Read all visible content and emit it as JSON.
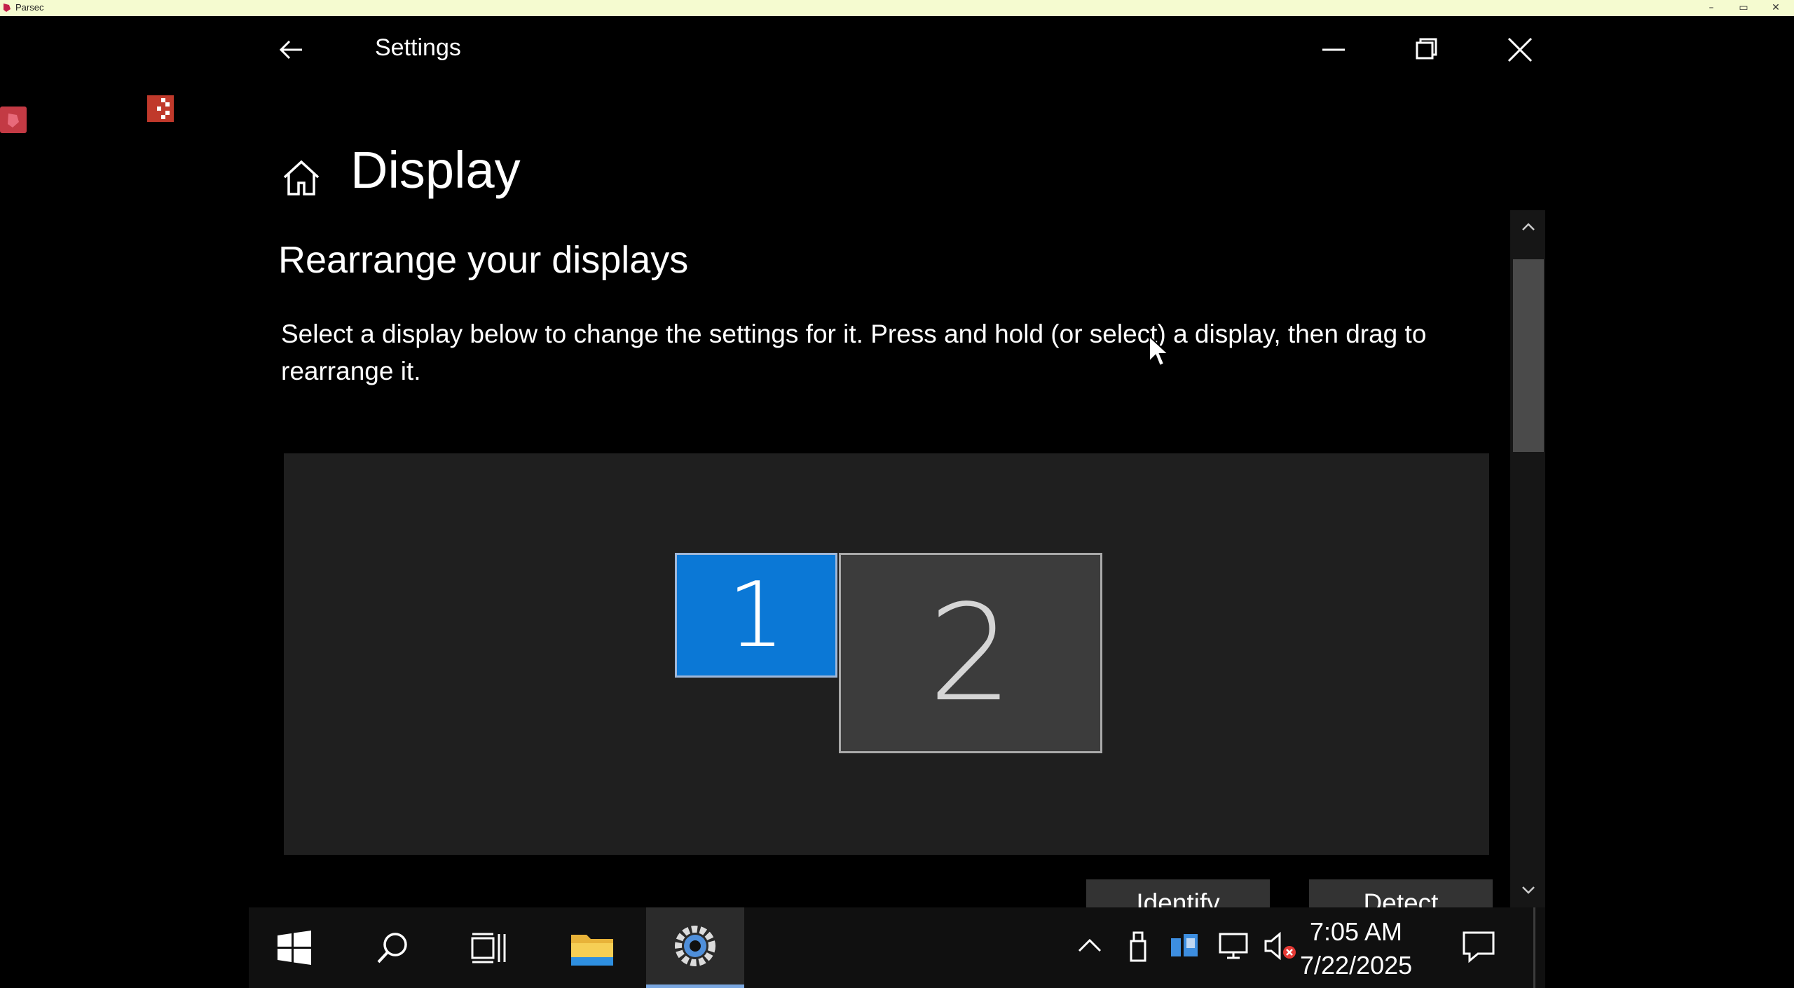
{
  "host": {
    "title": "Parsec",
    "minimize": "–",
    "maximize": "▭",
    "close": "✕"
  },
  "window": {
    "title": "Settings",
    "page_title": "Display",
    "section_title": "Rearrange your displays",
    "description": "Select a display below to change the settings for it. Press and hold (or select) a display, then drag to rearrange it.",
    "monitors": [
      {
        "label": "1",
        "selected": true
      },
      {
        "label": "2",
        "selected": false
      }
    ],
    "buttons": {
      "identify": "Identify",
      "detect": "Detect"
    }
  },
  "taskbar": {
    "time": "7:05 AM",
    "date": "7/22/2025",
    "icons": [
      "start-icon",
      "search-icon",
      "task-view-icon",
      "file-explorer-icon",
      "settings-app-icon"
    ],
    "tray": [
      "show-hidden-icons-chevron",
      "usb-eject-icon",
      "network-share-icon",
      "network-icon",
      "volume-muted-icon",
      "action-center-icon"
    ]
  },
  "colors": {
    "accent": "#0b78d6",
    "selected_display_border": "#9fb7d8",
    "taskbar_active": "#7aa7e0"
  }
}
